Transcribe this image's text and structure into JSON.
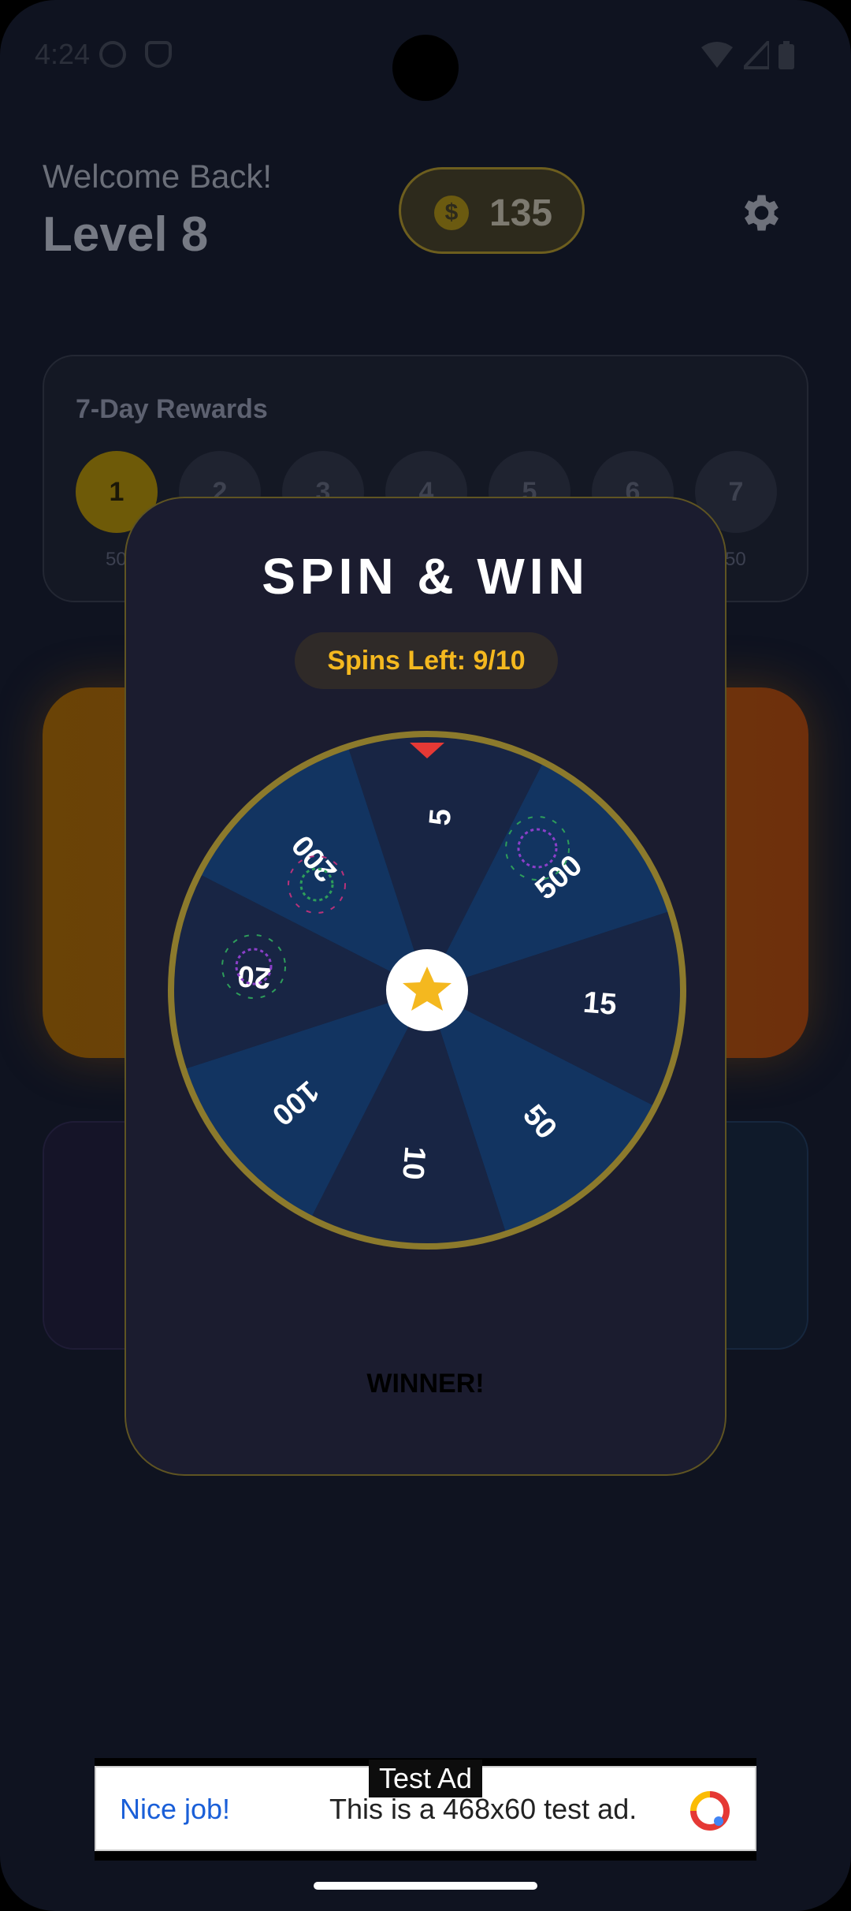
{
  "status_bar": {
    "time": "4:24"
  },
  "header": {
    "welcome": "Welcome Back!",
    "level": "Level 8",
    "coins": "135",
    "coin_symbol": "$"
  },
  "rewards": {
    "title": "7-Day Rewards",
    "days": [
      "1",
      "2",
      "3",
      "4",
      "5",
      "6",
      "7"
    ],
    "first_amount": "50",
    "last_amount": "50"
  },
  "dialog": {
    "title": "SPIN & WIN",
    "spins_left": "Spins Left: 9/10",
    "wheel_segments": [
      "5",
      "500",
      "15",
      "50",
      "10",
      "100",
      "20",
      "200"
    ],
    "winner": "WINNER!"
  },
  "ad": {
    "label": "Test Ad",
    "cta": "Nice job!",
    "message": "This is a 468x60 test ad."
  },
  "colors": {
    "gold": "#f4b81f",
    "wheel_rim": "#8c7a2c",
    "segment_dark": "#182544",
    "segment_light": "#123461",
    "pointer": "#e53935"
  }
}
